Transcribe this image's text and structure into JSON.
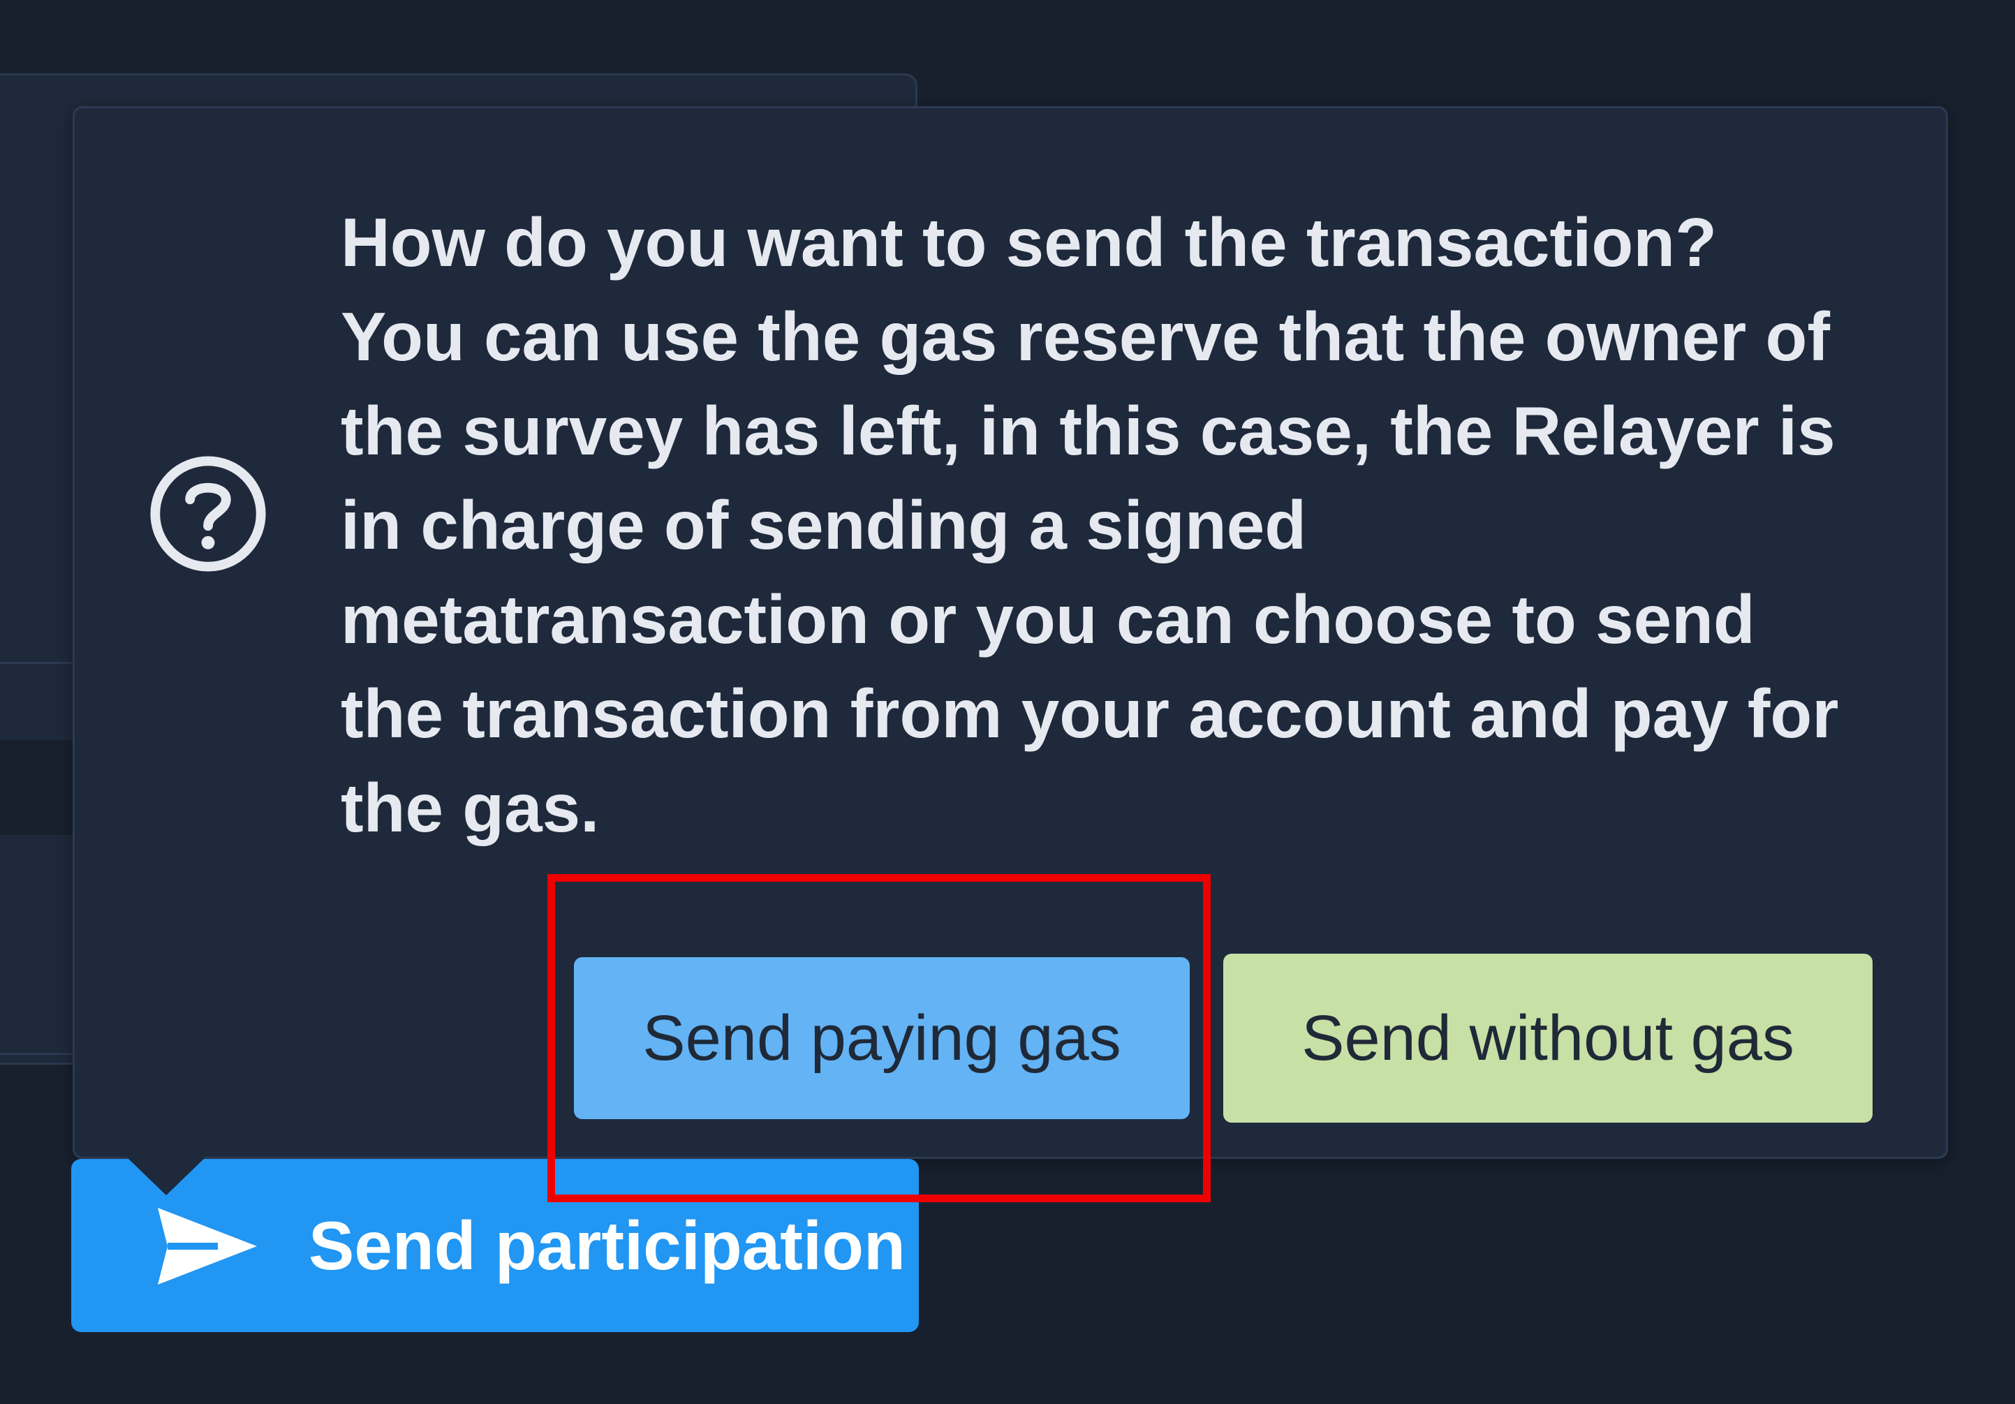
{
  "popover": {
    "message": "How do you want to send the transaction? You can use the gas reserve that the owner of the survey has left, in this case, the Relayer is in charge of sending a signed metatransaction or you can choose to send the transaction from your account and pay for the gas.",
    "icon": "question-circle-icon",
    "buttons": {
      "pay_gas_label": "Send paying gas",
      "without_gas_label": "Send without gas"
    }
  },
  "actions": {
    "send_participation_label": "Send participation",
    "send_icon": "paper-plane-icon"
  },
  "colors": {
    "background": "#18202e",
    "panel": "#1e293b",
    "pay_gas_button": "#63b3f5",
    "without_gas_button": "#c6e0a5",
    "primary_button": "#2196f3",
    "highlight": "#ee0000"
  }
}
